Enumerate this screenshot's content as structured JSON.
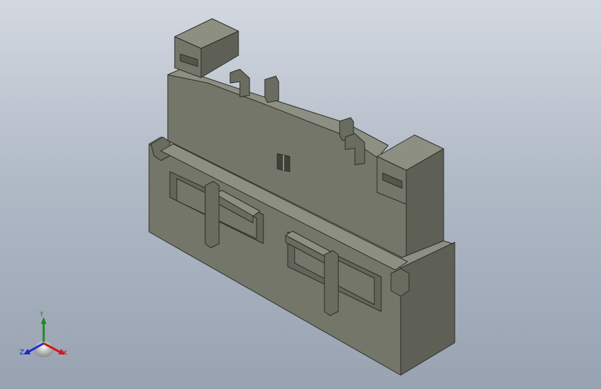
{
  "viewport": {
    "background_top": "#d3d8e0",
    "background_bottom": "#98a2b1"
  },
  "model": {
    "name": "3d-connector-housing-model",
    "face_colors": {
      "front": "#74766a",
      "side": "#5e6055",
      "top": "#8d8f82",
      "edge": "#2b2c27"
    }
  },
  "triad": {
    "x_label": "X",
    "y_label": "Y",
    "z_label": "Z",
    "x_color": "#d01818",
    "y_color": "#1e8a1e",
    "z_color": "#1a2ad0",
    "icon": "coordinate-triad-icon"
  }
}
